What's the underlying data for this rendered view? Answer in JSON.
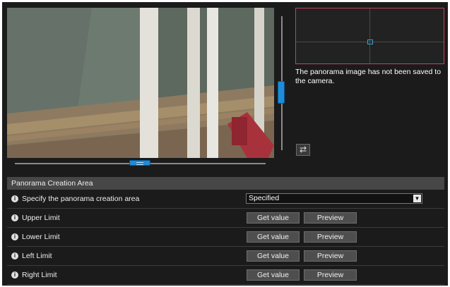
{
  "panorama": {
    "message": "The panorama image has not been saved to the camera."
  },
  "section": {
    "title": "Panorama Creation Area",
    "specify": {
      "label": "Specify the panorama creation area",
      "selected": "Specified"
    },
    "rows": [
      {
        "label": "Upper Limit",
        "get": "Get value",
        "preview": "Preview"
      },
      {
        "label": "Lower Limit",
        "get": "Get value",
        "preview": "Preview"
      },
      {
        "label": "Left Limit",
        "get": "Get value",
        "preview": "Preview"
      },
      {
        "label": "Right Limit",
        "get": "Get value",
        "preview": "Preview"
      }
    ]
  },
  "icons": {
    "info": "info-icon",
    "swap": "swap-arrows-icon",
    "dropdown": "chevron-down-icon"
  },
  "colors": {
    "accent": "#1e8cd8",
    "panorama_border": "#c0445d",
    "marker": "#2fa8c9",
    "background": "#1b1b1b"
  }
}
